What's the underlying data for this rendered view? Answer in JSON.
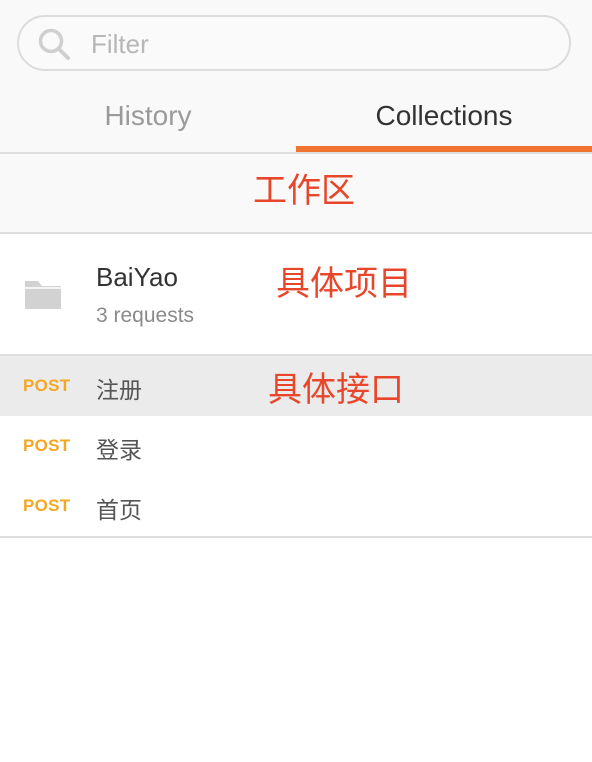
{
  "search": {
    "placeholder": "Filter",
    "value": ""
  },
  "tabs": [
    {
      "label": "History",
      "active": false
    },
    {
      "label": "Collections",
      "active": true
    }
  ],
  "annotations": {
    "workspace": "工作区",
    "project": "具体项目",
    "api": "具体接口"
  },
  "collection": {
    "name": "BaiYao",
    "count": "3 requests"
  },
  "requests": [
    {
      "method": "POST",
      "name": "注册",
      "active": true
    },
    {
      "method": "POST",
      "name": "登录",
      "active": false
    },
    {
      "method": "POST",
      "name": "首页",
      "active": false
    }
  ],
  "colors": {
    "accent": "#f07330",
    "method_post": "#f5a623",
    "annotation": "#e8462a",
    "active_row": "#ebebeb"
  },
  "icons": {
    "search": "search-icon",
    "new_collection": "new-folder-icon",
    "collection": "folder-icon"
  }
}
